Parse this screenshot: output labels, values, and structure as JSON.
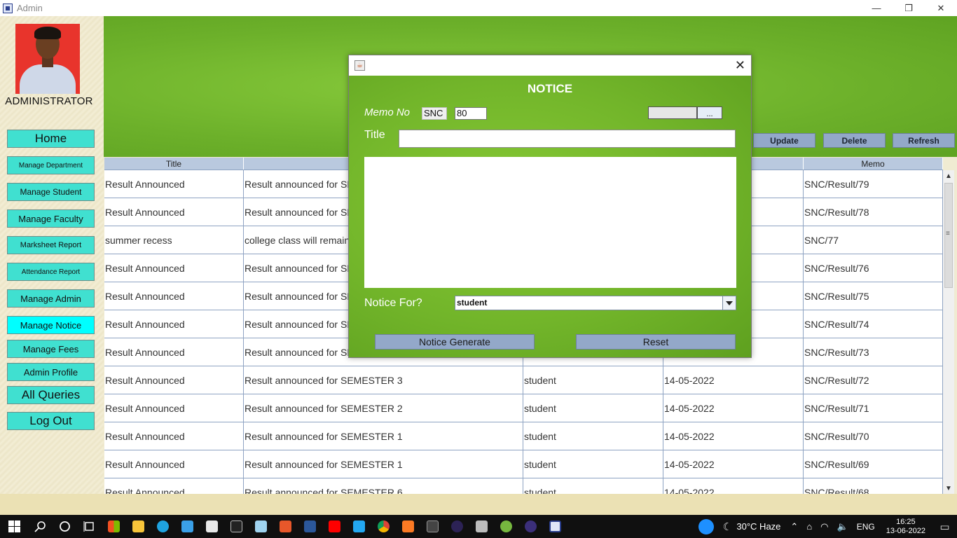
{
  "window": {
    "title": "Admin",
    "controls": [
      "—",
      "❐",
      "✕"
    ]
  },
  "sidebar": {
    "admin_label": "ADMINISTRATOR",
    "items": [
      {
        "label": "Home"
      },
      {
        "label": "Manage Department"
      },
      {
        "label": "Manage Student"
      },
      {
        "label": "Manage Faculty"
      },
      {
        "label": "Marksheet Report"
      },
      {
        "label": "Attendance Report"
      },
      {
        "label": "Manage Admin"
      },
      {
        "label": "Manage Notice",
        "active": true
      },
      {
        "label": "Manage Fees"
      },
      {
        "label": "Admin Profile"
      },
      {
        "label": "All Queries"
      },
      {
        "label": "Log Out"
      }
    ]
  },
  "toolbar": {
    "update": "Update",
    "delete": "Delete",
    "refresh": "Refresh"
  },
  "table": {
    "columns": [
      "Title",
      "",
      "",
      "",
      "Memo"
    ],
    "rows": [
      [
        "Result Announced",
        "Result announced for SE",
        "",
        "",
        "SNC/Result/79"
      ],
      [
        "Result Announced",
        "Result announced for SE",
        "",
        "",
        "SNC/Result/78"
      ],
      [
        "summer recess",
        "college class will remain",
        "",
        "",
        "SNC/77"
      ],
      [
        "Result Announced",
        "Result announced for SE",
        "",
        "",
        "SNC/Result/76"
      ],
      [
        "Result Announced",
        "Result announced for SE",
        "",
        "",
        "SNC/Result/75"
      ],
      [
        "Result Announced",
        "Result announced for SE",
        "",
        "",
        "SNC/Result/74"
      ],
      [
        "Result Announced",
        "Result announced for SE",
        "",
        "",
        "SNC/Result/73"
      ],
      [
        "Result Announced",
        "Result announced for SEMESTER 3",
        "student",
        "14-05-2022",
        "SNC/Result/72"
      ],
      [
        "Result Announced",
        "Result announced for SEMESTER 2",
        "student",
        "14-05-2022",
        "SNC/Result/71"
      ],
      [
        "Result Announced",
        "Result announced for SEMESTER 1",
        "student",
        "14-05-2022",
        "SNC/Result/70"
      ],
      [
        "Result Announced",
        "Result announced for SEMESTER 1",
        "student",
        "14-05-2022",
        "SNC/Result/69"
      ],
      [
        "Result Announced",
        "Result announced for SEMESTER 6",
        "student",
        "14-05-2022",
        "SNC/Result/68"
      ]
    ]
  },
  "dialog": {
    "heading": "NOTICE",
    "memo_label": "Memo No",
    "memo_prefix": "SNC",
    "memo_number": "80",
    "date_button": "...",
    "title_label": "Title",
    "title_value": "",
    "body_value": "",
    "notice_for_label": "Notice For?",
    "notice_for_value": "student",
    "generate_button": "Notice Generate",
    "reset_button": "Reset",
    "close": "✕"
  },
  "taskbar": {
    "weather": "30°C  Haze",
    "language": "ENG",
    "time": "16:25",
    "date": "13-06-2022"
  }
}
